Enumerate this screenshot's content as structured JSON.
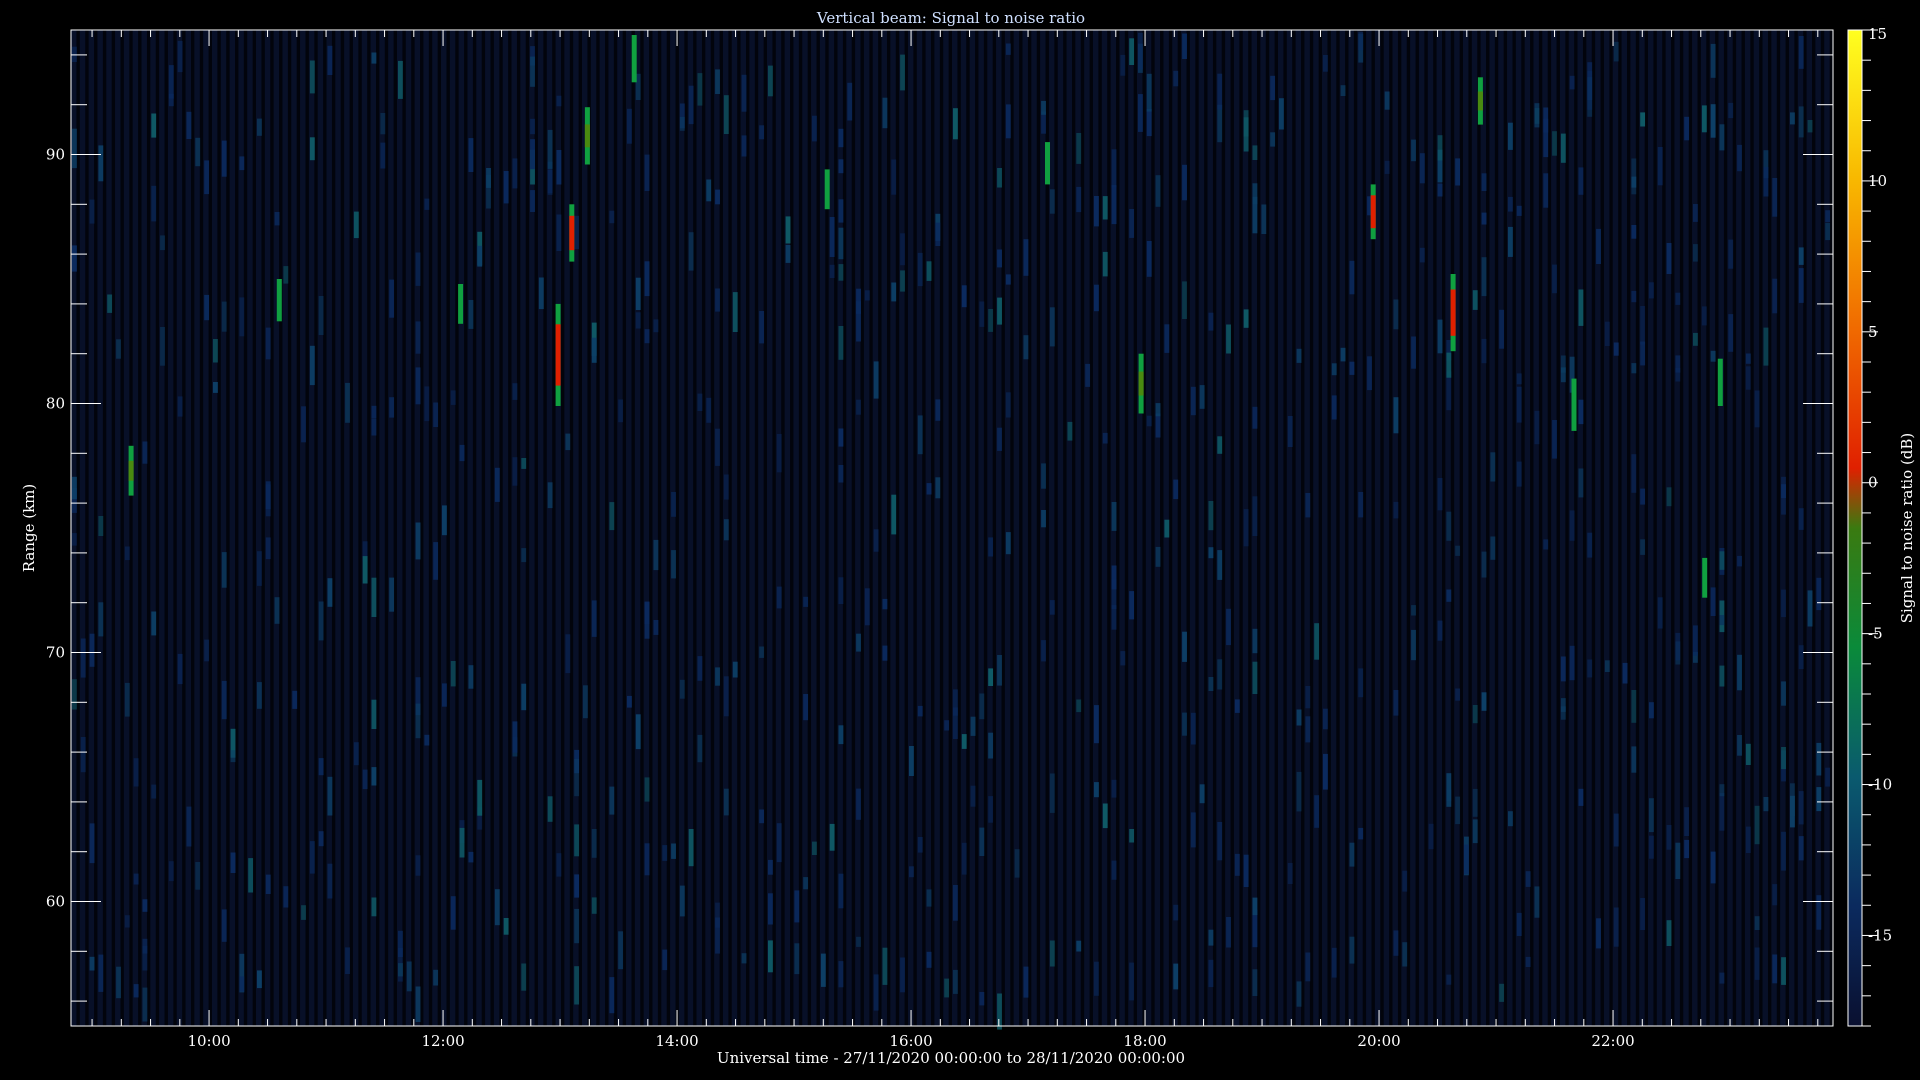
{
  "chart_data": {
    "type": "heatmap",
    "title": "Vertical beam: Signal to noise ratio",
    "xlabel": "Universal time - 27/11/2020 00:00:00 to 28/11/2020 00:00:00",
    "ylabel": "Range (km)",
    "colorbar_label": "Signal to noise ratio (dB)",
    "xlim_hours": [
      8.82,
      23.88
    ],
    "ylim": [
      55,
      95
    ],
    "x_ticks": [
      "10:00",
      "12:00",
      "14:00",
      "16:00",
      "18:00",
      "20:00",
      "22:00"
    ],
    "x_tick_hours": [
      10,
      12,
      14,
      16,
      18,
      20,
      22
    ],
    "y_ticks": [
      60,
      70,
      80,
      90
    ],
    "colorbar": {
      "range": [
        -18,
        15
      ],
      "ticks": [
        -15,
        -10,
        -5,
        0,
        5,
        10,
        15
      ],
      "colors": [
        "#0a1030",
        "#0b2a5e",
        "#0a5a6e",
        "#0a8a3a",
        "#20a020",
        "#b04010",
        "#e02000",
        "#f07000",
        "#f8c800",
        "#ffff20"
      ]
    },
    "background_snr_db": -16,
    "echoes": [
      {
        "t": "09:20",
        "range_km": [
          76.3,
          78.3
        ],
        "snr_db": -6
      },
      {
        "t": "10:36",
        "range_km": [
          83.3,
          85.0
        ],
        "snr_db": -8
      },
      {
        "t": "12:09",
        "range_km": [
          83.2,
          84.8
        ],
        "snr_db": -9
      },
      {
        "t": "12:59",
        "range_km": [
          79.9,
          84.0
        ],
        "snr_db": 0
      },
      {
        "t": "13:06",
        "range_km": [
          85.7,
          88.0
        ],
        "snr_db": 0
      },
      {
        "t": "13:14",
        "range_km": [
          89.6,
          91.9
        ],
        "snr_db": -4
      },
      {
        "t": "13:38",
        "range_km": [
          92.9,
          94.8
        ],
        "snr_db": -8
      },
      {
        "t": "15:17",
        "range_km": [
          87.8,
          89.4
        ],
        "snr_db": -7
      },
      {
        "t": "17:10",
        "range_km": [
          88.8,
          90.5
        ],
        "snr_db": -7
      },
      {
        "t": "17:58",
        "range_km": [
          79.6,
          82.0
        ],
        "snr_db": -5
      },
      {
        "t": "19:57",
        "range_km": [
          86.6,
          88.8
        ],
        "snr_db": 0
      },
      {
        "t": "20:38",
        "range_km": [
          82.1,
          85.2
        ],
        "snr_db": 0
      },
      {
        "t": "20:52",
        "range_km": [
          91.2,
          93.1
        ],
        "snr_db": -6
      },
      {
        "t": "21:40",
        "range_km": [
          78.9,
          81.0
        ],
        "snr_db": -7
      },
      {
        "t": "22:47",
        "range_km": [
          72.2,
          73.8
        ],
        "snr_db": -10
      },
      {
        "t": "22:55",
        "range_km": [
          79.9,
          81.8
        ],
        "snr_db": -7
      }
    ]
  }
}
